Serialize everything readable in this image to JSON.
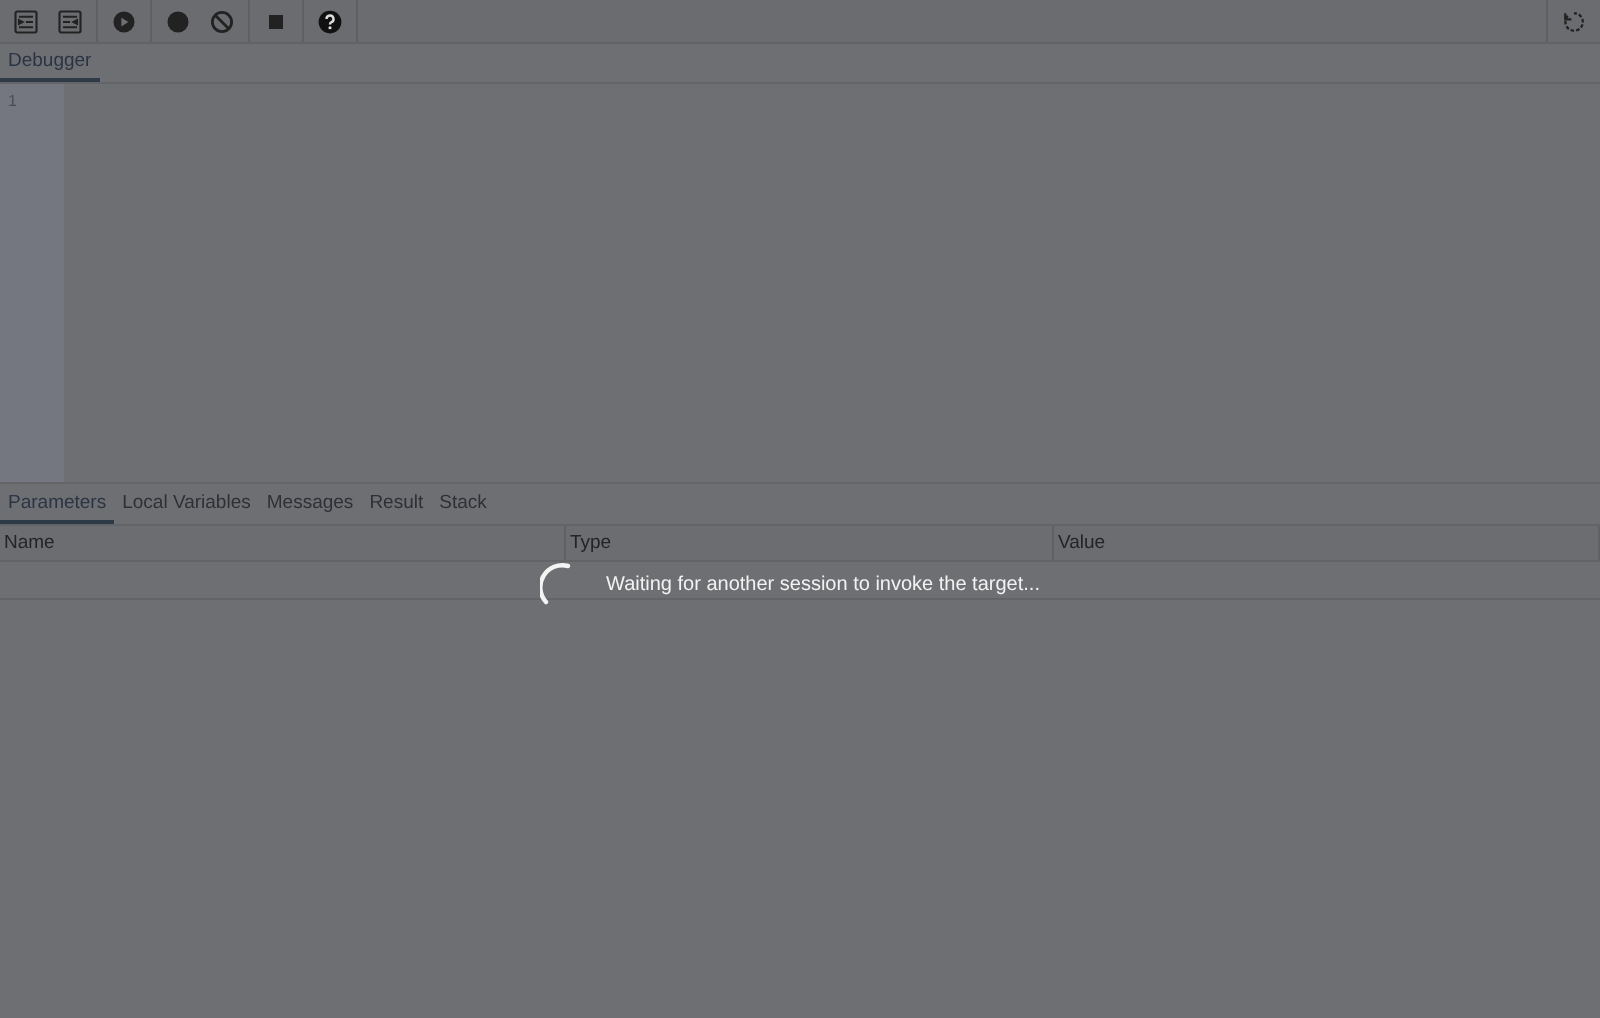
{
  "toolbar": {
    "groups": [
      {
        "buttons": [
          {
            "kind": "step-into"
          },
          {
            "kind": "step-over"
          }
        ]
      },
      {
        "buttons": [
          {
            "kind": "continue"
          }
        ]
      },
      {
        "buttons": [
          {
            "kind": "breakpoint"
          },
          {
            "kind": "clear"
          }
        ]
      },
      {
        "buttons": [
          {
            "kind": "stop"
          }
        ]
      },
      {
        "buttons": [
          {
            "kind": "help"
          }
        ]
      }
    ],
    "right_buttons": [
      {
        "kind": "restart"
      }
    ]
  },
  "editor_tabs": [
    {
      "label": "Debugger",
      "selected": true
    }
  ],
  "editor": {
    "line_numbers": [
      "1"
    ]
  },
  "panel_tabs": [
    {
      "label": "Parameters",
      "selected": true
    },
    {
      "label": "Local Variables",
      "selected": false
    },
    {
      "label": "Messages",
      "selected": false
    },
    {
      "label": "Result",
      "selected": false
    },
    {
      "label": "Stack",
      "selected": false
    }
  ],
  "table": {
    "columns": [
      "Name",
      "Type",
      "Value"
    ]
  },
  "loading": {
    "message": "Waiting for another session to invoke the target..."
  }
}
